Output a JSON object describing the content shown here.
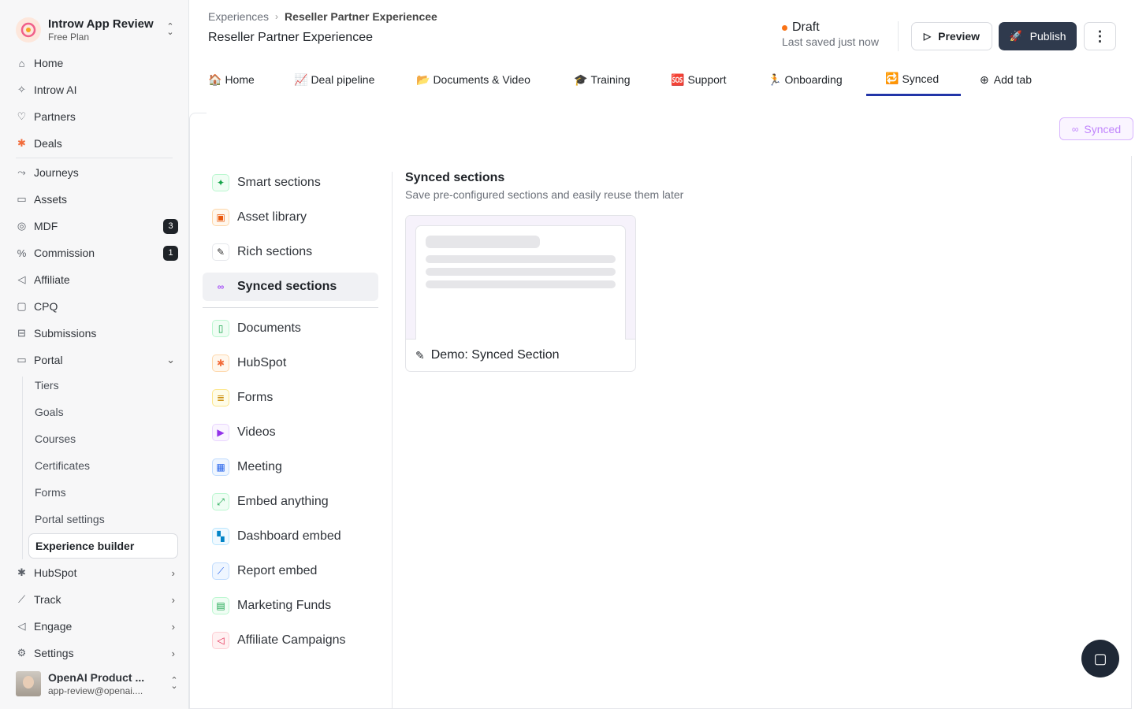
{
  "org": {
    "name": "Introw App Review",
    "plan": "Free Plan"
  },
  "nav": {
    "home": "Home",
    "introw_ai": "Introw AI",
    "partners": "Partners",
    "deals": "Deals",
    "journeys": "Journeys",
    "assets": "Assets",
    "mdf": "MDF",
    "mdf_badge": "3",
    "commission": "Commission",
    "commission_badge": "1",
    "affiliate": "Affiliate",
    "cpq": "CPQ",
    "submissions": "Submissions",
    "portal": "Portal",
    "portal_sub": [
      "Tiers",
      "Goals",
      "Courses",
      "Certificates",
      "Forms",
      "Portal settings",
      "Experience builder"
    ],
    "hubspot": "HubSpot",
    "track": "Track",
    "engage": "Engage",
    "settings": "Settings"
  },
  "user": {
    "name": "OpenAI Product ...",
    "email": "app-review@openai...."
  },
  "breadcrumb": {
    "parent": "Experiences",
    "current": "Reseller Partner Experiencee"
  },
  "page_title": "Reseller Partner Experiencee",
  "status": {
    "label": "Draft",
    "saved": "Last saved just now"
  },
  "actions": {
    "preview": "Preview",
    "publish": "Publish"
  },
  "tabs": [
    {
      "emoji": "🏠",
      "label": "Home"
    },
    {
      "emoji": "📈",
      "label": "Deal pipeline"
    },
    {
      "emoji": "📂",
      "label": "Documents & Video"
    },
    {
      "emoji": "🎓",
      "label": "Training"
    },
    {
      "emoji": "🆘",
      "label": "Support"
    },
    {
      "emoji": "🏃",
      "label": "Onboarding"
    },
    {
      "emoji": "🔁",
      "label": "Synced"
    }
  ],
  "add_tab": "Add tab",
  "synced_chip": "Synced",
  "menu": [
    "Smart sections",
    "Asset library",
    "Rich sections",
    "Synced sections",
    "Documents",
    "HubSpot",
    "Forms",
    "Videos",
    "Meeting",
    "Embed anything",
    "Dashboard embed",
    "Report embed",
    "Marketing Funds",
    "Affiliate Campaigns"
  ],
  "section": {
    "title": "Synced sections",
    "subtitle": "Save pre-configured sections and easily reuse them later",
    "card_label": "Demo: Synced Section"
  },
  "colors": {
    "accent": "#2235a8",
    "publish_bg": "#2f3a4d",
    "draft_dot": "#f97316",
    "synced_chip": "#c084fc"
  }
}
